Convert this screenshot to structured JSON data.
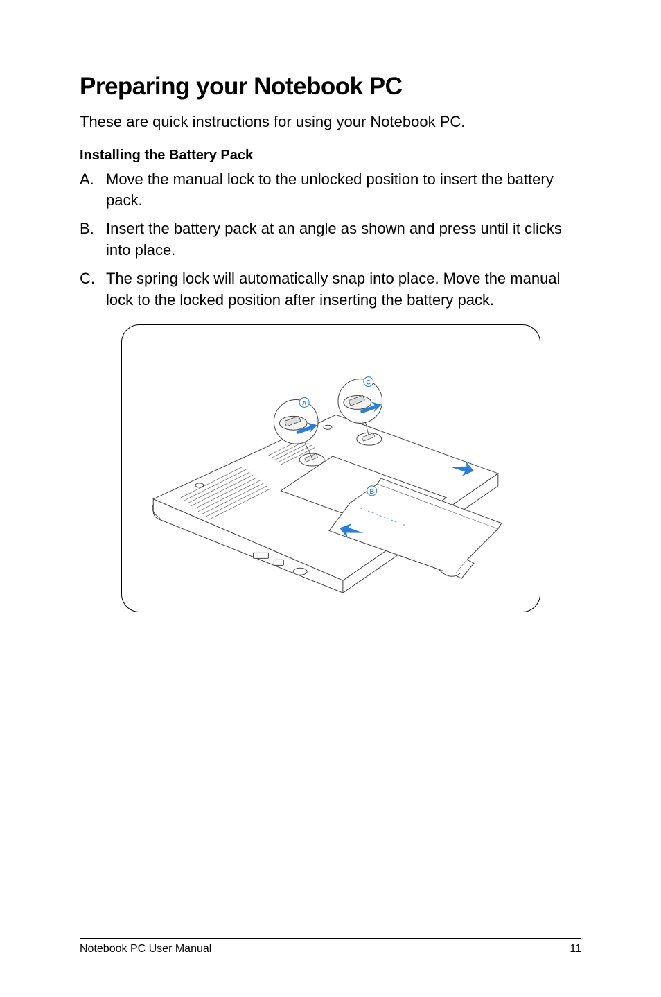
{
  "title": "Preparing your Notebook PC",
  "intro": "These are quick instructions for using your Notebook PC.",
  "subhead": "Installing the Battery Pack",
  "steps": [
    {
      "letter": "A.",
      "text": "Move the manual lock to the unlocked position to insert the battery pack."
    },
    {
      "letter": "B.",
      "text": "Insert the battery pack at an angle as shown and press until it clicks into place."
    },
    {
      "letter": "C.",
      "text": "The spring lock will automatically snap into place. Move the manual lock to the locked position after inserting the battery pack."
    }
  ],
  "diagram": {
    "callouts": {
      "a": "A",
      "b": "B",
      "c": "C"
    }
  },
  "footer": {
    "left": "Notebook PC User Manual",
    "right": "11"
  }
}
